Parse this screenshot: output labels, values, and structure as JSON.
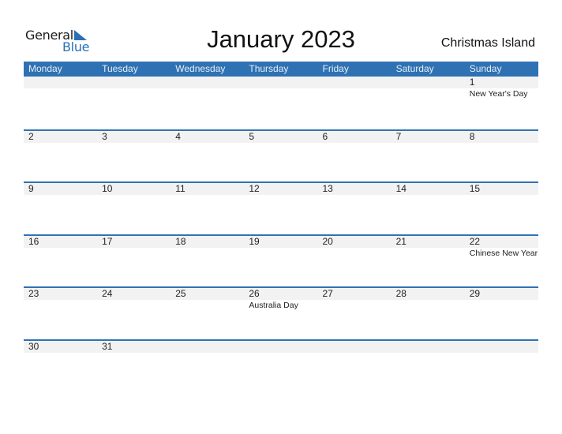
{
  "logo": {
    "word1": "General",
    "word2": "Blue"
  },
  "title": "January 2023",
  "country": "Christmas Island",
  "colors": {
    "accent": "#2e72b3",
    "strip": "#f2f2f2"
  },
  "weekdays": [
    "Monday",
    "Tuesday",
    "Wednesday",
    "Thursday",
    "Friday",
    "Saturday",
    "Sunday"
  ],
  "weeks": [
    [
      {
        "d": ""
      },
      {
        "d": ""
      },
      {
        "d": ""
      },
      {
        "d": ""
      },
      {
        "d": ""
      },
      {
        "d": ""
      },
      {
        "d": "1",
        "h": "New Year's Day"
      }
    ],
    [
      {
        "d": "2"
      },
      {
        "d": "3"
      },
      {
        "d": "4"
      },
      {
        "d": "5"
      },
      {
        "d": "6"
      },
      {
        "d": "7"
      },
      {
        "d": "8"
      }
    ],
    [
      {
        "d": "9"
      },
      {
        "d": "10"
      },
      {
        "d": "11"
      },
      {
        "d": "12"
      },
      {
        "d": "13"
      },
      {
        "d": "14"
      },
      {
        "d": "15"
      }
    ],
    [
      {
        "d": "16"
      },
      {
        "d": "17"
      },
      {
        "d": "18"
      },
      {
        "d": "19"
      },
      {
        "d": "20"
      },
      {
        "d": "21"
      },
      {
        "d": "22",
        "h": "Chinese New Year"
      }
    ],
    [
      {
        "d": "23"
      },
      {
        "d": "24"
      },
      {
        "d": "25"
      },
      {
        "d": "26",
        "h": "Australia Day"
      },
      {
        "d": "27"
      },
      {
        "d": "28"
      },
      {
        "d": "29"
      }
    ],
    [
      {
        "d": "30"
      },
      {
        "d": "31"
      },
      {
        "d": ""
      },
      {
        "d": ""
      },
      {
        "d": ""
      },
      {
        "d": ""
      },
      {
        "d": ""
      }
    ]
  ]
}
